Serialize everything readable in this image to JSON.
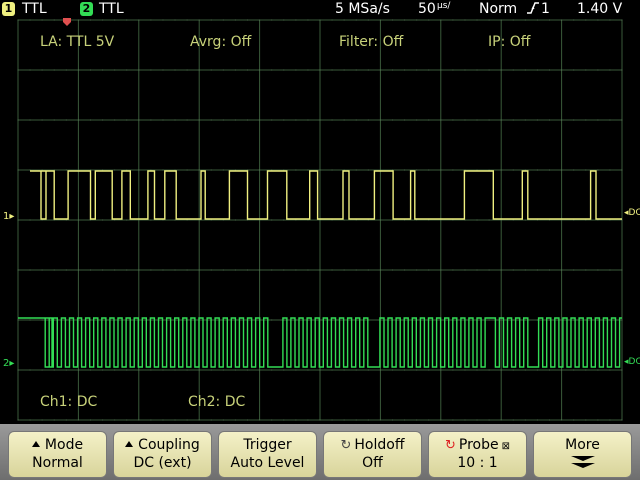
{
  "status_bar": {
    "ch1_number": "1",
    "ch1_label": "TTL",
    "ch2_number": "2",
    "ch2_label": "TTL",
    "sample_rate": "5 MSa/s",
    "timebase_value": "50",
    "timebase_unit": "µs/",
    "trigger_mode": "Norm",
    "trigger_slope_icon": "rising-edge-icon",
    "trigger_source": "1",
    "trigger_level": "1.40 V"
  },
  "screen_labels": {
    "la": "LA: TTL 5V",
    "avrg": "Avrg: Off",
    "filter": "Filter: Off",
    "ip": "IP: Off",
    "ch1_coupling": "Ch1: DC",
    "ch2_coupling": "Ch2: DC",
    "ch1_marker": "1",
    "ch2_marker": "2",
    "ch1_right": "DC",
    "ch2_right": "DC"
  },
  "softkeys": [
    {
      "line1": "Mode",
      "line2": "Normal",
      "icon": "arrow-up-icon"
    },
    {
      "line1": "Coupling",
      "line2": "DC (ext)",
      "icon": "arrow-up-icon"
    },
    {
      "line1": "Trigger",
      "line2": "Auto Level",
      "icon": ""
    },
    {
      "line1": "Holdoff",
      "line2": "Off",
      "icon": "rotate-knob-icon"
    },
    {
      "line1": "Probe",
      "line2": "10 : 1",
      "icon": "rotate-knob-icon"
    },
    {
      "line1": "More",
      "line2": "",
      "icon": "double-chevron-down-icon"
    }
  ],
  "colors": {
    "ch1": "#f0f080",
    "ch2": "#33dd55",
    "label": "#c8d27a",
    "grid": "#3a5a3a",
    "softkey": "#eeeab8"
  },
  "waveforms": {
    "ch1": {
      "high_level": 1,
      "low_level": 0,
      "transitions_div": [
        0,
        0,
        0.38,
        0.6,
        0.83,
        1.2,
        1.28,
        1.56,
        1.72,
        1.86,
        2.15,
        2.26,
        2.43,
        2.62,
        3.03,
        3.1,
        3.5,
        3.8,
        4.13,
        4.45,
        4.83,
        4.96,
        5.38,
        5.48,
        5.9,
        6.21,
        6.5,
        6.57,
        7.39,
        7.87,
        8.35,
        8.44,
        9.48,
        9.57
      ]
    },
    "ch2": {
      "start_high_div": 0.45,
      "period_div": 0.134,
      "duty": 0.5,
      "skip_regions": [
        [
          4.1,
          4.35
        ],
        [
          5.75,
          5.95
        ],
        [
          7.68,
          7.85
        ],
        [
          8.4,
          8.58
        ]
      ]
    }
  }
}
